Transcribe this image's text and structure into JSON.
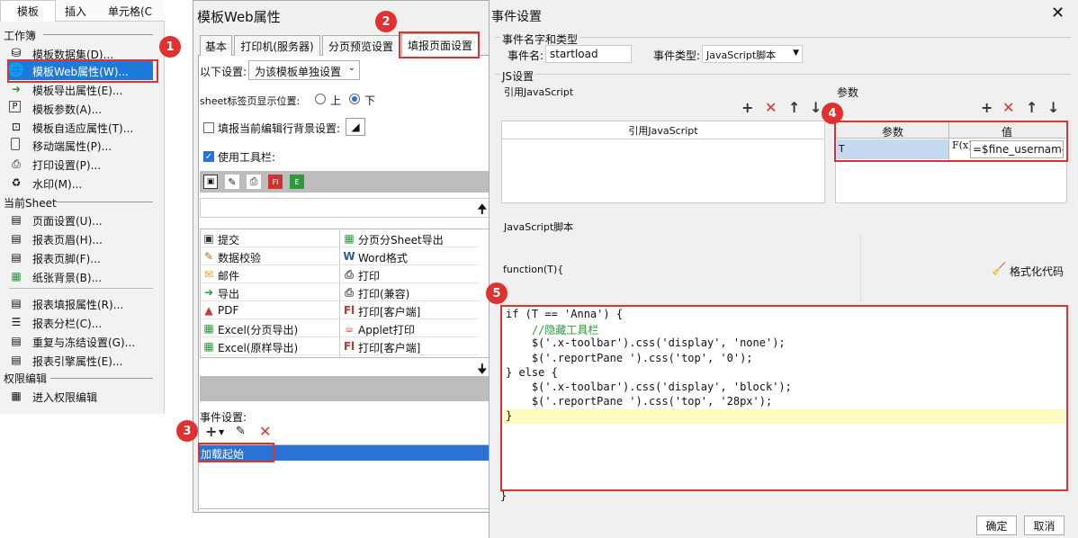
{
  "ribbon": {
    "tabs": [
      "模板",
      "插入",
      "单元格(C"
    ]
  },
  "left_menu": {
    "section1": "工作簿",
    "items1": [
      "模板数据集(D)...",
      "模板Web属性(W)...",
      "模板导出属性(E)...",
      "模板参数(A)...",
      "模板自适应属性(T)...",
      "移动端属性(P)...",
      "打印设置(P)...",
      "水印(M)..."
    ],
    "section2": "当前Sheet",
    "items2": [
      "页面设置(U)...",
      "报表页眉(H)...",
      "报表页脚(F)...",
      "纸张背景(B)..."
    ],
    "items3": [
      "报表填报属性(R)...",
      "报表分栏(C)...",
      "重复与冻结设置(G)...",
      "报表引擎属性(E)..."
    ],
    "section3": "权限编辑",
    "items4": [
      "进入权限编辑"
    ]
  },
  "web_dialog": {
    "title": "模板Web属性",
    "tabs": [
      "基本",
      "打印机(服务器)",
      "分页预览设置",
      "填报页面设置"
    ],
    "settings_label": "以下设置:",
    "settings_value": "为该模板单独设置",
    "sheet_label": "sheet标签页显示位置:",
    "radio_top": "上",
    "radio_bottom": "下",
    "bg_label": "填报当前编辑行背景设置:",
    "use_toolbar": "使用工具栏:",
    "buttons_col1": [
      "提交",
      "数据校验",
      "邮件",
      "导出",
      "PDF",
      "Excel(分页导出)",
      "Excel(原样导出)"
    ],
    "buttons_col2": [
      "分页分Sheet导出",
      "Word格式",
      "打印",
      "打印(兼容)",
      "打印[客户端]",
      "Applet打印",
      "打印[客户端]"
    ],
    "event_label": "事件设置:",
    "event_item": "加载起始"
  },
  "event_dialog": {
    "title": "事件设置",
    "group_name_type": "事件名字和类型",
    "event_name_label": "事件名:",
    "event_name_value": "startload",
    "event_type_label": "事件类型:",
    "event_type_value": "JavaScript脚本",
    "js_group": "JS设置",
    "ref_js_label": "引用JavaScript",
    "ref_js_header": "引用JavaScript",
    "params_label": "参数",
    "params_col_param": "参数",
    "params_col_value": "值",
    "param_name": "T",
    "param_value": "=$fine_username",
    "script_label": "JavaScript脚本",
    "function_sig": "function(T){",
    "format_code": "格式化代码",
    "code_lines": [
      "if (T == 'Anna') {",
      "    //隐藏工具栏",
      "    $('.x-toolbar').css('display', 'none');",
      "    $('.reportPane ').css('top', '0');",
      "} else {",
      "    $('.x-toolbar').css('display', 'block');",
      "    $('.reportPane ').css('top', '28px');",
      "}"
    ],
    "closing_brace": "}",
    "ok": "确定",
    "cancel": "取消"
  },
  "badges": [
    "1",
    "2",
    "3",
    "4",
    "5"
  ]
}
